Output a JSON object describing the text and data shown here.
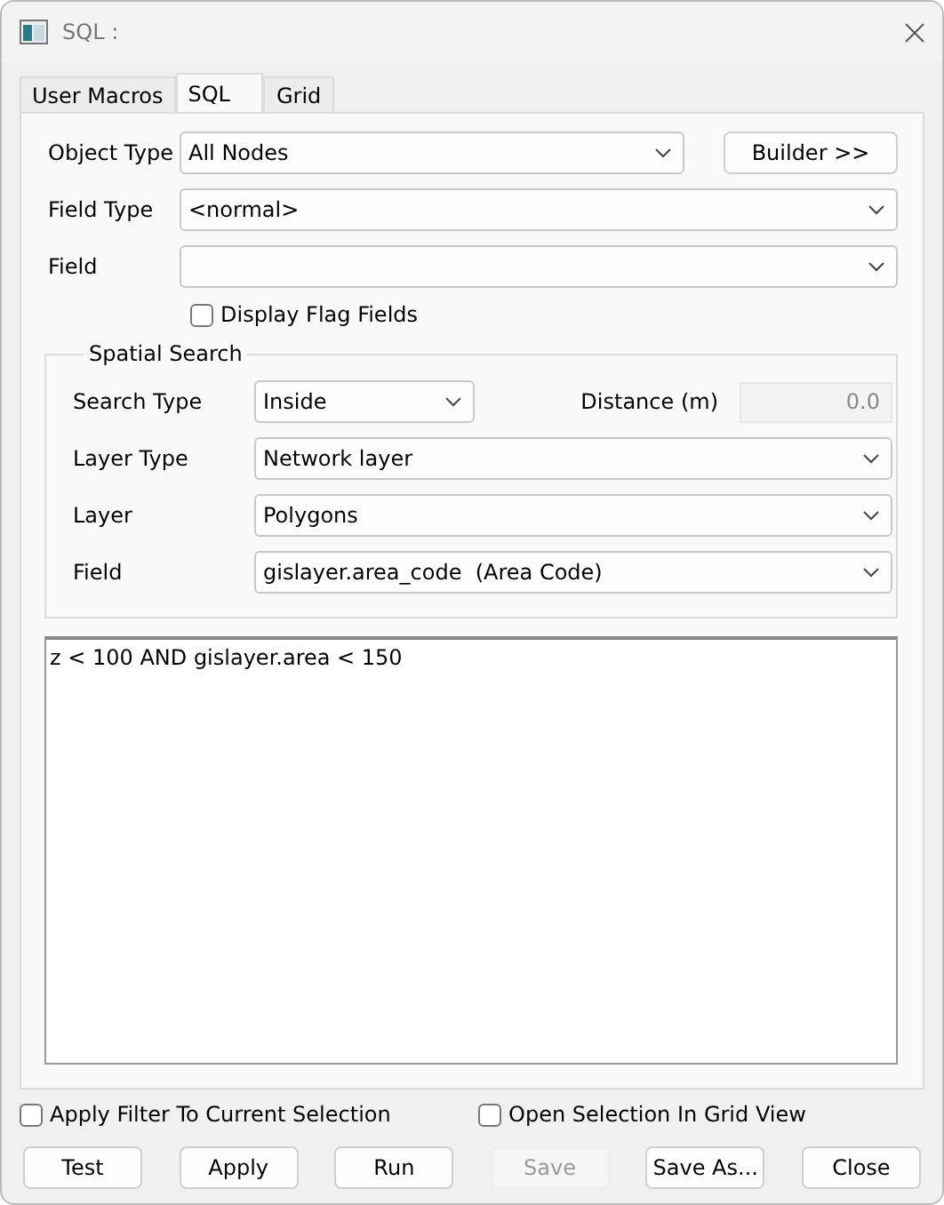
{
  "window": {
    "title": "SQL :"
  },
  "tabs": [
    {
      "label": "User Macros",
      "selected": false
    },
    {
      "label": "SQL",
      "selected": true
    },
    {
      "label": "Grid",
      "selected": false
    }
  ],
  "object_type": {
    "label": "Object Type",
    "value": "All Nodes"
  },
  "builder_button": "Builder >>",
  "field_type": {
    "label": "Field Type",
    "value": "<normal>"
  },
  "field": {
    "label": "Field"
  },
  "display_flag_fields": {
    "label": "Display Flag Fields",
    "checked": false
  },
  "spatial_search": {
    "title": "Spatial Search",
    "search_type": {
      "label": "Search Type",
      "value": "Inside"
    },
    "distance": {
      "label": "Distance (m)",
      "value": "0.0",
      "disabled": true
    },
    "layer_type": {
      "label": "Layer Type",
      "value": "Network layer"
    },
    "layer": {
      "label": "Layer",
      "value": "Polygons"
    },
    "field": {
      "label": "Field",
      "value": "gislayer.area_code  (Area Code)"
    }
  },
  "query": "z < 100 AND gislayer.area < 150",
  "options": [
    {
      "label": "Apply Filter To Current Selection",
      "checked": false
    },
    {
      "label": "Open Selection In Grid View",
      "checked": false
    }
  ],
  "buttons": [
    {
      "label": "Test",
      "disabled": false
    },
    {
      "label": "Apply",
      "disabled": false
    },
    {
      "label": "Run",
      "disabled": false
    },
    {
      "label": "Save",
      "disabled": true
    },
    {
      "label": "Save As...",
      "disabled": false
    },
    {
      "label": "Close",
      "disabled": false
    }
  ]
}
